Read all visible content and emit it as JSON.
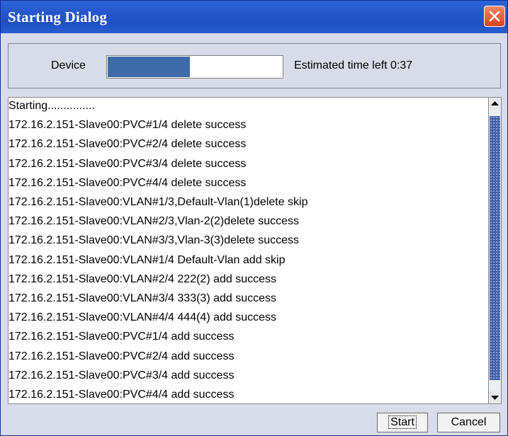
{
  "window": {
    "title": "Starting Dialog"
  },
  "status": {
    "device_label": "Device",
    "progress_percent": 47,
    "eta_text": "Estimated time left 0:37"
  },
  "log": [
    "Starting...............",
    "172.16.2.151-Slave00:PVC#1/4 delete success",
    "172.16.2.151-Slave00:PVC#2/4 delete success",
    "172.16.2.151-Slave00:PVC#3/4 delete success",
    "172.16.2.151-Slave00:PVC#4/4 delete success",
    "172.16.2.151-Slave00:VLAN#1/3,Default-Vlan(1)delete skip",
    "172.16.2.151-Slave00:VLAN#2/3,Vlan-2(2)delete success",
    "172.16.2.151-Slave00:VLAN#3/3,Vlan-3(3)delete success",
    "172.16.2.151-Slave00:VLAN#1/4 Default-Vlan add skip",
    "172.16.2.151-Slave00:VLAN#2/4 222(2) add success",
    "172.16.2.151-Slave00:VLAN#3/4 333(3) add success",
    "172.16.2.151-Slave00:VLAN#4/4 444(4) add success",
    "172.16.2.151-Slave00:PVC#1/4 add success",
    "172.16.2.151-Slave00:PVC#2/4 add success",
    "172.16.2.151-Slave00:PVC#3/4 add success",
    "172.16.2.151-Slave00:PVC#4/4 add success"
  ],
  "buttons": {
    "start": "Start",
    "cancel": "Cancel"
  },
  "icons": {
    "close": "close-icon",
    "up": "arrow-up-icon",
    "down": "arrow-down-icon"
  },
  "colors": {
    "title_bar": "#2456c9",
    "close": "#d9421d",
    "progress": "#3d6aa9",
    "scroll_thumb": "#3f5faa"
  }
}
